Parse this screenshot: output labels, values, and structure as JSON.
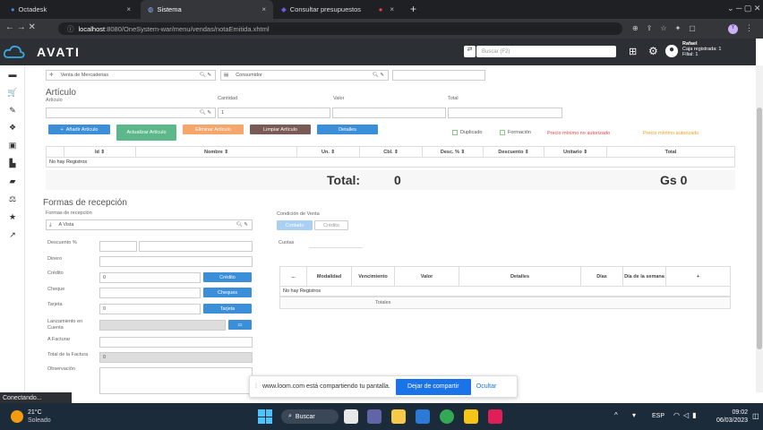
{
  "browser": {
    "tabs": [
      {
        "label": "Octadesk"
      },
      {
        "label": "Sistema"
      },
      {
        "label": "Consultar presupuestos"
      }
    ],
    "url_host": "localhost",
    "url_path": ":8080/OneSystem-war/menu/vendas/notaEmitida.xhtml",
    "status_text": "Conectando..."
  },
  "app": {
    "brand": "AVATI",
    "search_placeholder": "Buscar (F2)",
    "user": {
      "name": "Rafael",
      "caja": "Caja registrada: 1",
      "filial": "Filial: 1"
    }
  },
  "header_fields": {
    "operacion": "Venta de Mercaderias",
    "cliente": "Consumidor"
  },
  "articulo": {
    "title": "Artículo",
    "label_articulo": "Artículo",
    "label_cantidad": "Cantidad",
    "cantidad_value": "1",
    "label_valor": "Valor",
    "label_total": "Total",
    "buttons": {
      "add": "Añadir Artículo",
      "update": "Actualizar Artículo",
      "remove": "Eliminar Artículo",
      "clear": "Limpiar Artículo",
      "details": "Detalles"
    },
    "checkbox_duplicado": "Duplicado",
    "checkbox_formacion": "Formación",
    "warn_min_no": "Precio mínimo no autorizado",
    "warn_min_auth": "Precio mínimo autorizado",
    "table": {
      "columns": [
        "Id ⇕",
        "Nombre ⇕",
        "Un. ⇕",
        "Cbl. ⇕",
        "Desc. % ⇕",
        "Descuento ⇕",
        "Unitario ⇕",
        "Total"
      ],
      "empty": "No hay Registros",
      "total_label": "Total:",
      "total_qty": "0",
      "total_amount": "Gs 0"
    }
  },
  "recepcion": {
    "title": "Formas de recepción",
    "label_formas": "Formas de recepción",
    "forma_value": "A Vista",
    "descuento_label": "Descuento %",
    "dinero_label": "Dinero",
    "credito_label": "Crédito",
    "credito_value": "0",
    "credito_button": "Crédito",
    "cheque_label": "Cheque",
    "cheque_button": "Cheques",
    "tarjeta_label": "Tarjeta",
    "tarjeta_value": "0",
    "tarjeta_button": "Tarjeta",
    "lanzamiento_label": "Lanzamiento en Cuenta",
    "afacturar_label": "A Facturar",
    "total_factura_label": "Total de la Factura",
    "total_factura_value": "0",
    "observacion_label": "Observación"
  },
  "condicion": {
    "label": "Condición de Venta",
    "opt_contado": "Contado",
    "opt_credito": "Crédito",
    "cuotas_label": "Cuotas",
    "table": {
      "columns": [
        "...",
        "Modalidad",
        "Vencimiento",
        "Valor",
        "Detalles",
        "Días",
        "Día de la semana",
        "+"
      ],
      "empty": "No hay Registros",
      "totales": "Totales"
    }
  },
  "share_bar": {
    "text": "www.loom.com está compartiendo tu pantalla.",
    "stop": "Dejar de compartir",
    "hide": "Ocultar"
  },
  "taskbar": {
    "weather_temp": "21°C",
    "weather_desc": "Soleado",
    "search": "Buscar",
    "lang": "ESP",
    "time": "09:02",
    "date": "06/03/2023"
  },
  "colors": {
    "blue": "#3b8fd9",
    "green": "#5cb88a",
    "orange": "#f5a66b",
    "brown": "#7a5a54",
    "header": "#2c3035"
  }
}
